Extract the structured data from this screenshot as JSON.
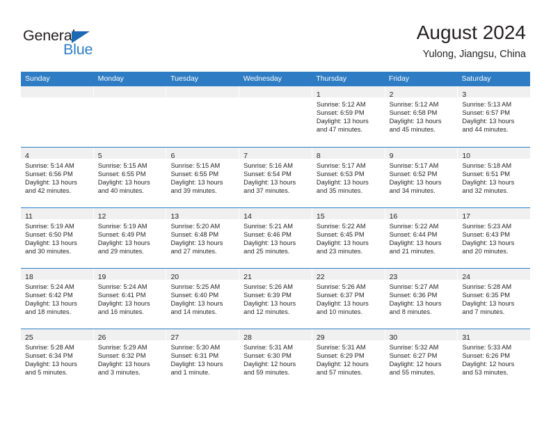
{
  "brand": {
    "name_part1": "General",
    "name_part2": "Blue",
    "accent_color": "#2e7dc4"
  },
  "header": {
    "title": "August 2024",
    "subtitle": "Yulong, Jiangsu, China"
  },
  "calendar": {
    "day_headers": [
      "Sunday",
      "Monday",
      "Tuesday",
      "Wednesday",
      "Thursday",
      "Friday",
      "Saturday"
    ],
    "header_bg": "#2e7dc4",
    "daynum_bg": "#f0f0f0",
    "weeks": [
      [
        {
          "day": "",
          "lines": []
        },
        {
          "day": "",
          "lines": []
        },
        {
          "day": "",
          "lines": []
        },
        {
          "day": "",
          "lines": []
        },
        {
          "day": "1",
          "lines": [
            "Sunrise: 5:12 AM",
            "Sunset: 6:59 PM",
            "Daylight: 13 hours",
            "and 47 minutes."
          ]
        },
        {
          "day": "2",
          "lines": [
            "Sunrise: 5:12 AM",
            "Sunset: 6:58 PM",
            "Daylight: 13 hours",
            "and 45 minutes."
          ]
        },
        {
          "day": "3",
          "lines": [
            "Sunrise: 5:13 AM",
            "Sunset: 6:57 PM",
            "Daylight: 13 hours",
            "and 44 minutes."
          ]
        }
      ],
      [
        {
          "day": "4",
          "lines": [
            "Sunrise: 5:14 AM",
            "Sunset: 6:56 PM",
            "Daylight: 13 hours",
            "and 42 minutes."
          ]
        },
        {
          "day": "5",
          "lines": [
            "Sunrise: 5:15 AM",
            "Sunset: 6:55 PM",
            "Daylight: 13 hours",
            "and 40 minutes."
          ]
        },
        {
          "day": "6",
          "lines": [
            "Sunrise: 5:15 AM",
            "Sunset: 6:55 PM",
            "Daylight: 13 hours",
            "and 39 minutes."
          ]
        },
        {
          "day": "7",
          "lines": [
            "Sunrise: 5:16 AM",
            "Sunset: 6:54 PM",
            "Daylight: 13 hours",
            "and 37 minutes."
          ]
        },
        {
          "day": "8",
          "lines": [
            "Sunrise: 5:17 AM",
            "Sunset: 6:53 PM",
            "Daylight: 13 hours",
            "and 35 minutes."
          ]
        },
        {
          "day": "9",
          "lines": [
            "Sunrise: 5:17 AM",
            "Sunset: 6:52 PM",
            "Daylight: 13 hours",
            "and 34 minutes."
          ]
        },
        {
          "day": "10",
          "lines": [
            "Sunrise: 5:18 AM",
            "Sunset: 6:51 PM",
            "Daylight: 13 hours",
            "and 32 minutes."
          ]
        }
      ],
      [
        {
          "day": "11",
          "lines": [
            "Sunrise: 5:19 AM",
            "Sunset: 6:50 PM",
            "Daylight: 13 hours",
            "and 30 minutes."
          ]
        },
        {
          "day": "12",
          "lines": [
            "Sunrise: 5:19 AM",
            "Sunset: 6:49 PM",
            "Daylight: 13 hours",
            "and 29 minutes."
          ]
        },
        {
          "day": "13",
          "lines": [
            "Sunrise: 5:20 AM",
            "Sunset: 6:48 PM",
            "Daylight: 13 hours",
            "and 27 minutes."
          ]
        },
        {
          "day": "14",
          "lines": [
            "Sunrise: 5:21 AM",
            "Sunset: 6:46 PM",
            "Daylight: 13 hours",
            "and 25 minutes."
          ]
        },
        {
          "day": "15",
          "lines": [
            "Sunrise: 5:22 AM",
            "Sunset: 6:45 PM",
            "Daylight: 13 hours",
            "and 23 minutes."
          ]
        },
        {
          "day": "16",
          "lines": [
            "Sunrise: 5:22 AM",
            "Sunset: 6:44 PM",
            "Daylight: 13 hours",
            "and 21 minutes."
          ]
        },
        {
          "day": "17",
          "lines": [
            "Sunrise: 5:23 AM",
            "Sunset: 6:43 PM",
            "Daylight: 13 hours",
            "and 20 minutes."
          ]
        }
      ],
      [
        {
          "day": "18",
          "lines": [
            "Sunrise: 5:24 AM",
            "Sunset: 6:42 PM",
            "Daylight: 13 hours",
            "and 18 minutes."
          ]
        },
        {
          "day": "19",
          "lines": [
            "Sunrise: 5:24 AM",
            "Sunset: 6:41 PM",
            "Daylight: 13 hours",
            "and 16 minutes."
          ]
        },
        {
          "day": "20",
          "lines": [
            "Sunrise: 5:25 AM",
            "Sunset: 6:40 PM",
            "Daylight: 13 hours",
            "and 14 minutes."
          ]
        },
        {
          "day": "21",
          "lines": [
            "Sunrise: 5:26 AM",
            "Sunset: 6:39 PM",
            "Daylight: 13 hours",
            "and 12 minutes."
          ]
        },
        {
          "day": "22",
          "lines": [
            "Sunrise: 5:26 AM",
            "Sunset: 6:37 PM",
            "Daylight: 13 hours",
            "and 10 minutes."
          ]
        },
        {
          "day": "23",
          "lines": [
            "Sunrise: 5:27 AM",
            "Sunset: 6:36 PM",
            "Daylight: 13 hours",
            "and 8 minutes."
          ]
        },
        {
          "day": "24",
          "lines": [
            "Sunrise: 5:28 AM",
            "Sunset: 6:35 PM",
            "Daylight: 13 hours",
            "and 7 minutes."
          ]
        }
      ],
      [
        {
          "day": "25",
          "lines": [
            "Sunrise: 5:28 AM",
            "Sunset: 6:34 PM",
            "Daylight: 13 hours",
            "and 5 minutes."
          ]
        },
        {
          "day": "26",
          "lines": [
            "Sunrise: 5:29 AM",
            "Sunset: 6:32 PM",
            "Daylight: 13 hours",
            "and 3 minutes."
          ]
        },
        {
          "day": "27",
          "lines": [
            "Sunrise: 5:30 AM",
            "Sunset: 6:31 PM",
            "Daylight: 13 hours",
            "and 1 minute."
          ]
        },
        {
          "day": "28",
          "lines": [
            "Sunrise: 5:31 AM",
            "Sunset: 6:30 PM",
            "Daylight: 12 hours",
            "and 59 minutes."
          ]
        },
        {
          "day": "29",
          "lines": [
            "Sunrise: 5:31 AM",
            "Sunset: 6:29 PM",
            "Daylight: 12 hours",
            "and 57 minutes."
          ]
        },
        {
          "day": "30",
          "lines": [
            "Sunrise: 5:32 AM",
            "Sunset: 6:27 PM",
            "Daylight: 12 hours",
            "and 55 minutes."
          ]
        },
        {
          "day": "31",
          "lines": [
            "Sunrise: 5:33 AM",
            "Sunset: 6:26 PM",
            "Daylight: 12 hours",
            "and 53 minutes."
          ]
        }
      ]
    ]
  }
}
